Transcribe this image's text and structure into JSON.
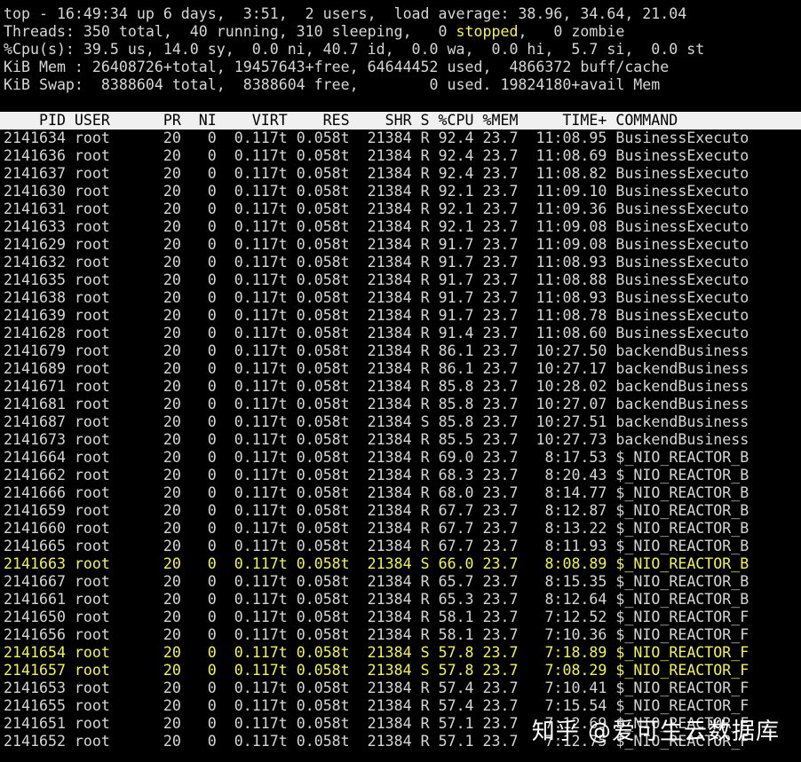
{
  "summary": {
    "top_line": "top - 16:49:34 up 6 days,  3:51,  2 users,  load average: 38.96, 34.64, 21.04",
    "threads_pre": "Threads: 350 total,  40 running, 310 sleeping,   0 ",
    "threads_stopped": "stopped",
    "threads_post": ",   0 zombie",
    "cpu_line": "%Cpu(s): 39.5 us, 14.0 sy,  0.0 ni, 40.7 id,  0.0 wa,  0.0 hi,  5.7 si,  0.0 st",
    "mem_line": "KiB Mem : 26408726+total, 19457643+free, 64644452 used,  4866372 buff/cache",
    "swap_line": "KiB Swap:  8388604 total,  8388604 free,        0 used. 19824180+avail Mem"
  },
  "table": {
    "header": "    PID USER      PR  NI    VIRT    RES    SHR S %CPU %MEM     TIME+ COMMAND",
    "rows": [
      {
        "pid": "2141634",
        "user": "root",
        "pr": "20",
        "ni": "0",
        "virt": "0.117t",
        "res": "0.058t",
        "shr": "21384",
        "s": "R",
        "cpu": "92.4",
        "mem": "23.7",
        "time": "11:08.95",
        "command": "BusinessExecuto",
        "highlight": false
      },
      {
        "pid": "2141636",
        "user": "root",
        "pr": "20",
        "ni": "0",
        "virt": "0.117t",
        "res": "0.058t",
        "shr": "21384",
        "s": "R",
        "cpu": "92.4",
        "mem": "23.7",
        "time": "11:08.69",
        "command": "BusinessExecuto",
        "highlight": false
      },
      {
        "pid": "2141637",
        "user": "root",
        "pr": "20",
        "ni": "0",
        "virt": "0.117t",
        "res": "0.058t",
        "shr": "21384",
        "s": "R",
        "cpu": "92.4",
        "mem": "23.7",
        "time": "11:08.82",
        "command": "BusinessExecuto",
        "highlight": false
      },
      {
        "pid": "2141630",
        "user": "root",
        "pr": "20",
        "ni": "0",
        "virt": "0.117t",
        "res": "0.058t",
        "shr": "21384",
        "s": "R",
        "cpu": "92.1",
        "mem": "23.7",
        "time": "11:09.10",
        "command": "BusinessExecuto",
        "highlight": false
      },
      {
        "pid": "2141631",
        "user": "root",
        "pr": "20",
        "ni": "0",
        "virt": "0.117t",
        "res": "0.058t",
        "shr": "21384",
        "s": "R",
        "cpu": "92.1",
        "mem": "23.7",
        "time": "11:09.36",
        "command": "BusinessExecuto",
        "highlight": false
      },
      {
        "pid": "2141633",
        "user": "root",
        "pr": "20",
        "ni": "0",
        "virt": "0.117t",
        "res": "0.058t",
        "shr": "21384",
        "s": "R",
        "cpu": "92.1",
        "mem": "23.7",
        "time": "11:09.08",
        "command": "BusinessExecuto",
        "highlight": false
      },
      {
        "pid": "2141629",
        "user": "root",
        "pr": "20",
        "ni": "0",
        "virt": "0.117t",
        "res": "0.058t",
        "shr": "21384",
        "s": "R",
        "cpu": "91.7",
        "mem": "23.7",
        "time": "11:09.08",
        "command": "BusinessExecuto",
        "highlight": false
      },
      {
        "pid": "2141632",
        "user": "root",
        "pr": "20",
        "ni": "0",
        "virt": "0.117t",
        "res": "0.058t",
        "shr": "21384",
        "s": "R",
        "cpu": "91.7",
        "mem": "23.7",
        "time": "11:08.93",
        "command": "BusinessExecuto",
        "highlight": false
      },
      {
        "pid": "2141635",
        "user": "root",
        "pr": "20",
        "ni": "0",
        "virt": "0.117t",
        "res": "0.058t",
        "shr": "21384",
        "s": "R",
        "cpu": "91.7",
        "mem": "23.7",
        "time": "11:08.88",
        "command": "BusinessExecuto",
        "highlight": false
      },
      {
        "pid": "2141638",
        "user": "root",
        "pr": "20",
        "ni": "0",
        "virt": "0.117t",
        "res": "0.058t",
        "shr": "21384",
        "s": "R",
        "cpu": "91.7",
        "mem": "23.7",
        "time": "11:08.93",
        "command": "BusinessExecuto",
        "highlight": false
      },
      {
        "pid": "2141639",
        "user": "root",
        "pr": "20",
        "ni": "0",
        "virt": "0.117t",
        "res": "0.058t",
        "shr": "21384",
        "s": "R",
        "cpu": "91.7",
        "mem": "23.7",
        "time": "11:08.78",
        "command": "BusinessExecuto",
        "highlight": false
      },
      {
        "pid": "2141628",
        "user": "root",
        "pr": "20",
        "ni": "0",
        "virt": "0.117t",
        "res": "0.058t",
        "shr": "21384",
        "s": "R",
        "cpu": "91.4",
        "mem": "23.7",
        "time": "11:08.60",
        "command": "BusinessExecuto",
        "highlight": false
      },
      {
        "pid": "2141679",
        "user": "root",
        "pr": "20",
        "ni": "0",
        "virt": "0.117t",
        "res": "0.058t",
        "shr": "21384",
        "s": "R",
        "cpu": "86.1",
        "mem": "23.7",
        "time": "10:27.50",
        "command": "backendBusiness",
        "highlight": false
      },
      {
        "pid": "2141689",
        "user": "root",
        "pr": "20",
        "ni": "0",
        "virt": "0.117t",
        "res": "0.058t",
        "shr": "21384",
        "s": "R",
        "cpu": "86.1",
        "mem": "23.7",
        "time": "10:27.17",
        "command": "backendBusiness",
        "highlight": false
      },
      {
        "pid": "2141671",
        "user": "root",
        "pr": "20",
        "ni": "0",
        "virt": "0.117t",
        "res": "0.058t",
        "shr": "21384",
        "s": "R",
        "cpu": "85.8",
        "mem": "23.7",
        "time": "10:28.02",
        "command": "backendBusiness",
        "highlight": false
      },
      {
        "pid": "2141681",
        "user": "root",
        "pr": "20",
        "ni": "0",
        "virt": "0.117t",
        "res": "0.058t",
        "shr": "21384",
        "s": "R",
        "cpu": "85.8",
        "mem": "23.7",
        "time": "10:27.07",
        "command": "backendBusiness",
        "highlight": false
      },
      {
        "pid": "2141687",
        "user": "root",
        "pr": "20",
        "ni": "0",
        "virt": "0.117t",
        "res": "0.058t",
        "shr": "21384",
        "s": "S",
        "cpu": "85.8",
        "mem": "23.7",
        "time": "10:27.51",
        "command": "backendBusiness",
        "highlight": false
      },
      {
        "pid": "2141673",
        "user": "root",
        "pr": "20",
        "ni": "0",
        "virt": "0.117t",
        "res": "0.058t",
        "shr": "21384",
        "s": "R",
        "cpu": "85.5",
        "mem": "23.7",
        "time": "10:27.73",
        "command": "backendBusiness",
        "highlight": false
      },
      {
        "pid": "2141664",
        "user": "root",
        "pr": "20",
        "ni": "0",
        "virt": "0.117t",
        "res": "0.058t",
        "shr": "21384",
        "s": "R",
        "cpu": "69.0",
        "mem": "23.7",
        "time": "8:17.53",
        "command": "$_NIO_REACTOR_B",
        "highlight": false
      },
      {
        "pid": "2141662",
        "user": "root",
        "pr": "20",
        "ni": "0",
        "virt": "0.117t",
        "res": "0.058t",
        "shr": "21384",
        "s": "R",
        "cpu": "68.3",
        "mem": "23.7",
        "time": "8:20.43",
        "command": "$_NIO_REACTOR_B",
        "highlight": false
      },
      {
        "pid": "2141666",
        "user": "root",
        "pr": "20",
        "ni": "0",
        "virt": "0.117t",
        "res": "0.058t",
        "shr": "21384",
        "s": "R",
        "cpu": "68.0",
        "mem": "23.7",
        "time": "8:14.77",
        "command": "$_NIO_REACTOR_B",
        "highlight": false
      },
      {
        "pid": "2141659",
        "user": "root",
        "pr": "20",
        "ni": "0",
        "virt": "0.117t",
        "res": "0.058t",
        "shr": "21384",
        "s": "R",
        "cpu": "67.7",
        "mem": "23.7",
        "time": "8:12.87",
        "command": "$_NIO_REACTOR_B",
        "highlight": false
      },
      {
        "pid": "2141660",
        "user": "root",
        "pr": "20",
        "ni": "0",
        "virt": "0.117t",
        "res": "0.058t",
        "shr": "21384",
        "s": "R",
        "cpu": "67.7",
        "mem": "23.7",
        "time": "8:13.22",
        "command": "$_NIO_REACTOR_B",
        "highlight": false
      },
      {
        "pid": "2141665",
        "user": "root",
        "pr": "20",
        "ni": "0",
        "virt": "0.117t",
        "res": "0.058t",
        "shr": "21384",
        "s": "R",
        "cpu": "67.7",
        "mem": "23.7",
        "time": "8:11.93",
        "command": "$_NIO_REACTOR_B",
        "highlight": false
      },
      {
        "pid": "2141663",
        "user": "root",
        "pr": "20",
        "ni": "0",
        "virt": "0.117t",
        "res": "0.058t",
        "shr": "21384",
        "s": "S",
        "cpu": "66.0",
        "mem": "23.7",
        "time": "8:08.89",
        "command": "$_NIO_REACTOR_B",
        "highlight": true
      },
      {
        "pid": "2141667",
        "user": "root",
        "pr": "20",
        "ni": "0",
        "virt": "0.117t",
        "res": "0.058t",
        "shr": "21384",
        "s": "R",
        "cpu": "65.7",
        "mem": "23.7",
        "time": "8:15.35",
        "command": "$_NIO_REACTOR_B",
        "highlight": false
      },
      {
        "pid": "2141661",
        "user": "root",
        "pr": "20",
        "ni": "0",
        "virt": "0.117t",
        "res": "0.058t",
        "shr": "21384",
        "s": "R",
        "cpu": "65.3",
        "mem": "23.7",
        "time": "8:12.64",
        "command": "$_NIO_REACTOR_B",
        "highlight": false
      },
      {
        "pid": "2141650",
        "user": "root",
        "pr": "20",
        "ni": "0",
        "virt": "0.117t",
        "res": "0.058t",
        "shr": "21384",
        "s": "R",
        "cpu": "58.1",
        "mem": "23.7",
        "time": "7:12.52",
        "command": "$_NIO_REACTOR_F",
        "highlight": false
      },
      {
        "pid": "2141656",
        "user": "root",
        "pr": "20",
        "ni": "0",
        "virt": "0.117t",
        "res": "0.058t",
        "shr": "21384",
        "s": "R",
        "cpu": "58.1",
        "mem": "23.7",
        "time": "7:10.36",
        "command": "$_NIO_REACTOR_F",
        "highlight": false
      },
      {
        "pid": "2141654",
        "user": "root",
        "pr": "20",
        "ni": "0",
        "virt": "0.117t",
        "res": "0.058t",
        "shr": "21384",
        "s": "S",
        "cpu": "57.8",
        "mem": "23.7",
        "time": "7:18.89",
        "command": "$_NIO_REACTOR_F",
        "highlight": true
      },
      {
        "pid": "2141657",
        "user": "root",
        "pr": "20",
        "ni": "0",
        "virt": "0.117t",
        "res": "0.058t",
        "shr": "21384",
        "s": "S",
        "cpu": "57.8",
        "mem": "23.7",
        "time": "7:08.29",
        "command": "$_NIO_REACTOR_F",
        "highlight": true
      },
      {
        "pid": "2141653",
        "user": "root",
        "pr": "20",
        "ni": "0",
        "virt": "0.117t",
        "res": "0.058t",
        "shr": "21384",
        "s": "R",
        "cpu": "57.4",
        "mem": "23.7",
        "time": "7:10.41",
        "command": "$_NIO_REACTOR_F",
        "highlight": false
      },
      {
        "pid": "2141655",
        "user": "root",
        "pr": "20",
        "ni": "0",
        "virt": "0.117t",
        "res": "0.058t",
        "shr": "21384",
        "s": "R",
        "cpu": "57.4",
        "mem": "23.7",
        "time": "7:15.54",
        "command": "$_NIO_REACTOR_F",
        "highlight": false
      },
      {
        "pid": "2141651",
        "user": "root",
        "pr": "20",
        "ni": "0",
        "virt": "0.117t",
        "res": "0.058t",
        "shr": "21384",
        "s": "R",
        "cpu": "57.1",
        "mem": "23.7",
        "time": "7:12.69",
        "command": "$_NIO_REACTOR_F",
        "highlight": false
      },
      {
        "pid": "2141652",
        "user": "root",
        "pr": "20",
        "ni": "0",
        "virt": "0.117t",
        "res": "0.058t",
        "shr": "21384",
        "s": "R",
        "cpu": "57.1",
        "mem": "23.7",
        "time": "7:12.75",
        "command": "$_NIO_REACTOR_F",
        "highlight": false
      }
    ]
  },
  "watermark": "知乎 @爱可生云数据库",
  "colors": {
    "background": "#000000",
    "text": "#d6d6d6",
    "highlight": "#f4f450",
    "header_bg": "#f0f0f0"
  }
}
